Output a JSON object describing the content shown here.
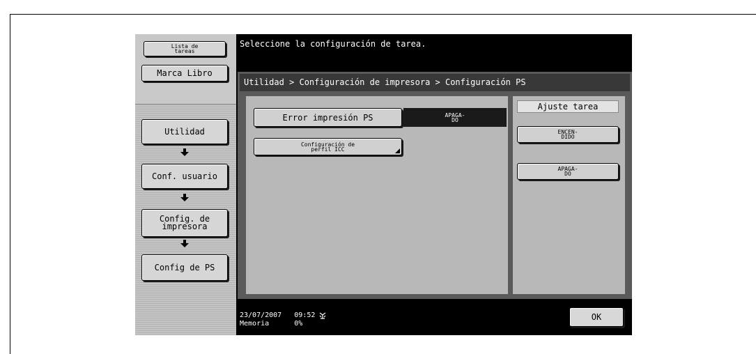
{
  "header": {
    "message": "Seleccione la configuración de tarea."
  },
  "sidebar": {
    "job_list_label": "Lista de\ntareas",
    "bookmark_label": "Marca Libro",
    "nav": [
      {
        "label": "Utilidad"
      },
      {
        "label": "Conf. usuario"
      },
      {
        "label": "Config. de\nimpresora"
      },
      {
        "label": "Config de PS"
      }
    ]
  },
  "breadcrumb": "Utilidad > Configuración de impresora > Configuración PS",
  "settings": {
    "ps_error_label": "Error impresión PS",
    "ps_error_value": "APAGA-\nDO",
    "icc_profile_label": "Configuración de\nperfil ICC"
  },
  "job_setting": {
    "header": "Ajuste tarea",
    "on_label": "ENCEN-\nDIDO",
    "off_label": "APAGA-\nDO"
  },
  "footer": {
    "date": "23/07/2007",
    "time": "09:52",
    "memory_label": "Memoria",
    "memory_value": "0%"
  },
  "ok_label": "OK",
  "icons": {
    "arrows": "down-arrow-icon",
    "network": "network-status-icon"
  },
  "colors": {
    "screen": "#000000",
    "panel": "#5a5a5a",
    "button": "#d0d0d0",
    "area": "#b8b8b8"
  }
}
